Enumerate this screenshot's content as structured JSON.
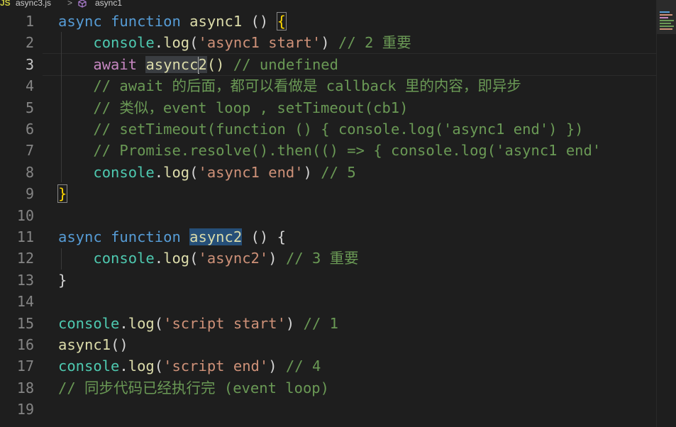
{
  "breadcrumb": {
    "lang_badge": "JS",
    "file": "async3.js",
    "separator": ">",
    "symbol": "async1"
  },
  "editor": {
    "lines": [
      {
        "n": "1",
        "tokens": [
          [
            "kw",
            "async"
          ],
          [
            "pn",
            " "
          ],
          [
            "kw",
            "function"
          ],
          [
            "pn",
            " "
          ],
          [
            "fn",
            "async1"
          ],
          [
            "pn",
            " () "
          ],
          [
            "brk",
            "{"
          ]
        ]
      },
      {
        "n": "2",
        "tokens": [
          [
            "pn",
            "    "
          ],
          [
            "obj",
            "console"
          ],
          [
            "pn",
            "."
          ],
          [
            "fn",
            "log"
          ],
          [
            "pn",
            "("
          ],
          [
            "str",
            "'async1 start'"
          ],
          [
            "pn",
            ") "
          ],
          [
            "cm",
            "// 2 重要"
          ]
        ]
      },
      {
        "n": "3",
        "tokens": [
          [
            "pn",
            "    "
          ],
          [
            "kw2",
            "await"
          ],
          [
            "pn",
            " "
          ],
          [
            "hl",
            "async"
          ],
          [
            "hlc",
            "c"
          ],
          [
            "cursor",
            ""
          ],
          [
            "hl",
            "2"
          ],
          [
            "fn",
            "()"
          ],
          [
            "pn",
            " "
          ],
          [
            "cm",
            "// undefined"
          ]
        ]
      },
      {
        "n": "4",
        "tokens": [
          [
            "pn",
            "    "
          ],
          [
            "cm",
            "// await 的后面，都可以看做是 callback 里的内容，即异步"
          ]
        ]
      },
      {
        "n": "5",
        "tokens": [
          [
            "pn",
            "    "
          ],
          [
            "cm",
            "// 类似，event loop , setTimeout(cb1)"
          ]
        ]
      },
      {
        "n": "6",
        "tokens": [
          [
            "pn",
            "    "
          ],
          [
            "cm",
            "// setTimeout(function () { console.log('async1 end') })"
          ]
        ]
      },
      {
        "n": "7",
        "tokens": [
          [
            "pn",
            "    "
          ],
          [
            "cm",
            "// Promise.resolve().then(() => { console.log('async1 end'"
          ]
        ]
      },
      {
        "n": "8",
        "tokens": [
          [
            "pn",
            "    "
          ],
          [
            "obj",
            "console"
          ],
          [
            "pn",
            "."
          ],
          [
            "fn",
            "log"
          ],
          [
            "pn",
            "("
          ],
          [
            "str",
            "'async1 end'"
          ],
          [
            "pn",
            ") "
          ],
          [
            "cm",
            "// 5"
          ]
        ]
      },
      {
        "n": "9",
        "tokens": [
          [
            "brk",
            "}"
          ]
        ]
      },
      {
        "n": "10",
        "tokens": []
      },
      {
        "n": "11",
        "tokens": [
          [
            "kw",
            "async"
          ],
          [
            "pn",
            " "
          ],
          [
            "kw",
            "function"
          ],
          [
            "pn",
            " "
          ],
          [
            "hl2",
            "async2"
          ],
          [
            "pn",
            " () {"
          ]
        ]
      },
      {
        "n": "12",
        "tokens": [
          [
            "pn",
            "    "
          ],
          [
            "obj",
            "console"
          ],
          [
            "pn",
            "."
          ],
          [
            "fn",
            "log"
          ],
          [
            "pn",
            "("
          ],
          [
            "str",
            "'async2'"
          ],
          [
            "pn",
            ") "
          ],
          [
            "cm",
            "// 3 重要"
          ]
        ]
      },
      {
        "n": "13",
        "tokens": [
          [
            "pn",
            "}"
          ]
        ]
      },
      {
        "n": "14",
        "tokens": []
      },
      {
        "n": "15",
        "tokens": [
          [
            "obj",
            "console"
          ],
          [
            "pn",
            "."
          ],
          [
            "fn",
            "log"
          ],
          [
            "pn",
            "("
          ],
          [
            "str",
            "'script start'"
          ],
          [
            "pn",
            ") "
          ],
          [
            "cm",
            "// 1"
          ]
        ]
      },
      {
        "n": "16",
        "tokens": [
          [
            "fn",
            "async1"
          ],
          [
            "pn",
            "()"
          ]
        ]
      },
      {
        "n": "17",
        "tokens": [
          [
            "obj",
            "console"
          ],
          [
            "pn",
            "."
          ],
          [
            "fn",
            "log"
          ],
          [
            "pn",
            "("
          ],
          [
            "str",
            "'script end'"
          ],
          [
            "pn",
            ") "
          ],
          [
            "cm",
            "// 4"
          ]
        ]
      },
      {
        "n": "18",
        "tokens": [
          [
            "cm",
            "// 同步代码已经执行完 (event loop)"
          ]
        ]
      },
      {
        "n": "19",
        "tokens": []
      }
    ],
    "active_line": "3"
  },
  "colors": {
    "background": "#1e1e1e",
    "keyword": "#569cd6",
    "control_keyword": "#c586c0",
    "function": "#dcdcaa",
    "object": "#4ec9b0",
    "string": "#ce9178",
    "comment": "#6a9955"
  },
  "icons": {
    "breadcrumb_symbol": "cube-icon"
  }
}
